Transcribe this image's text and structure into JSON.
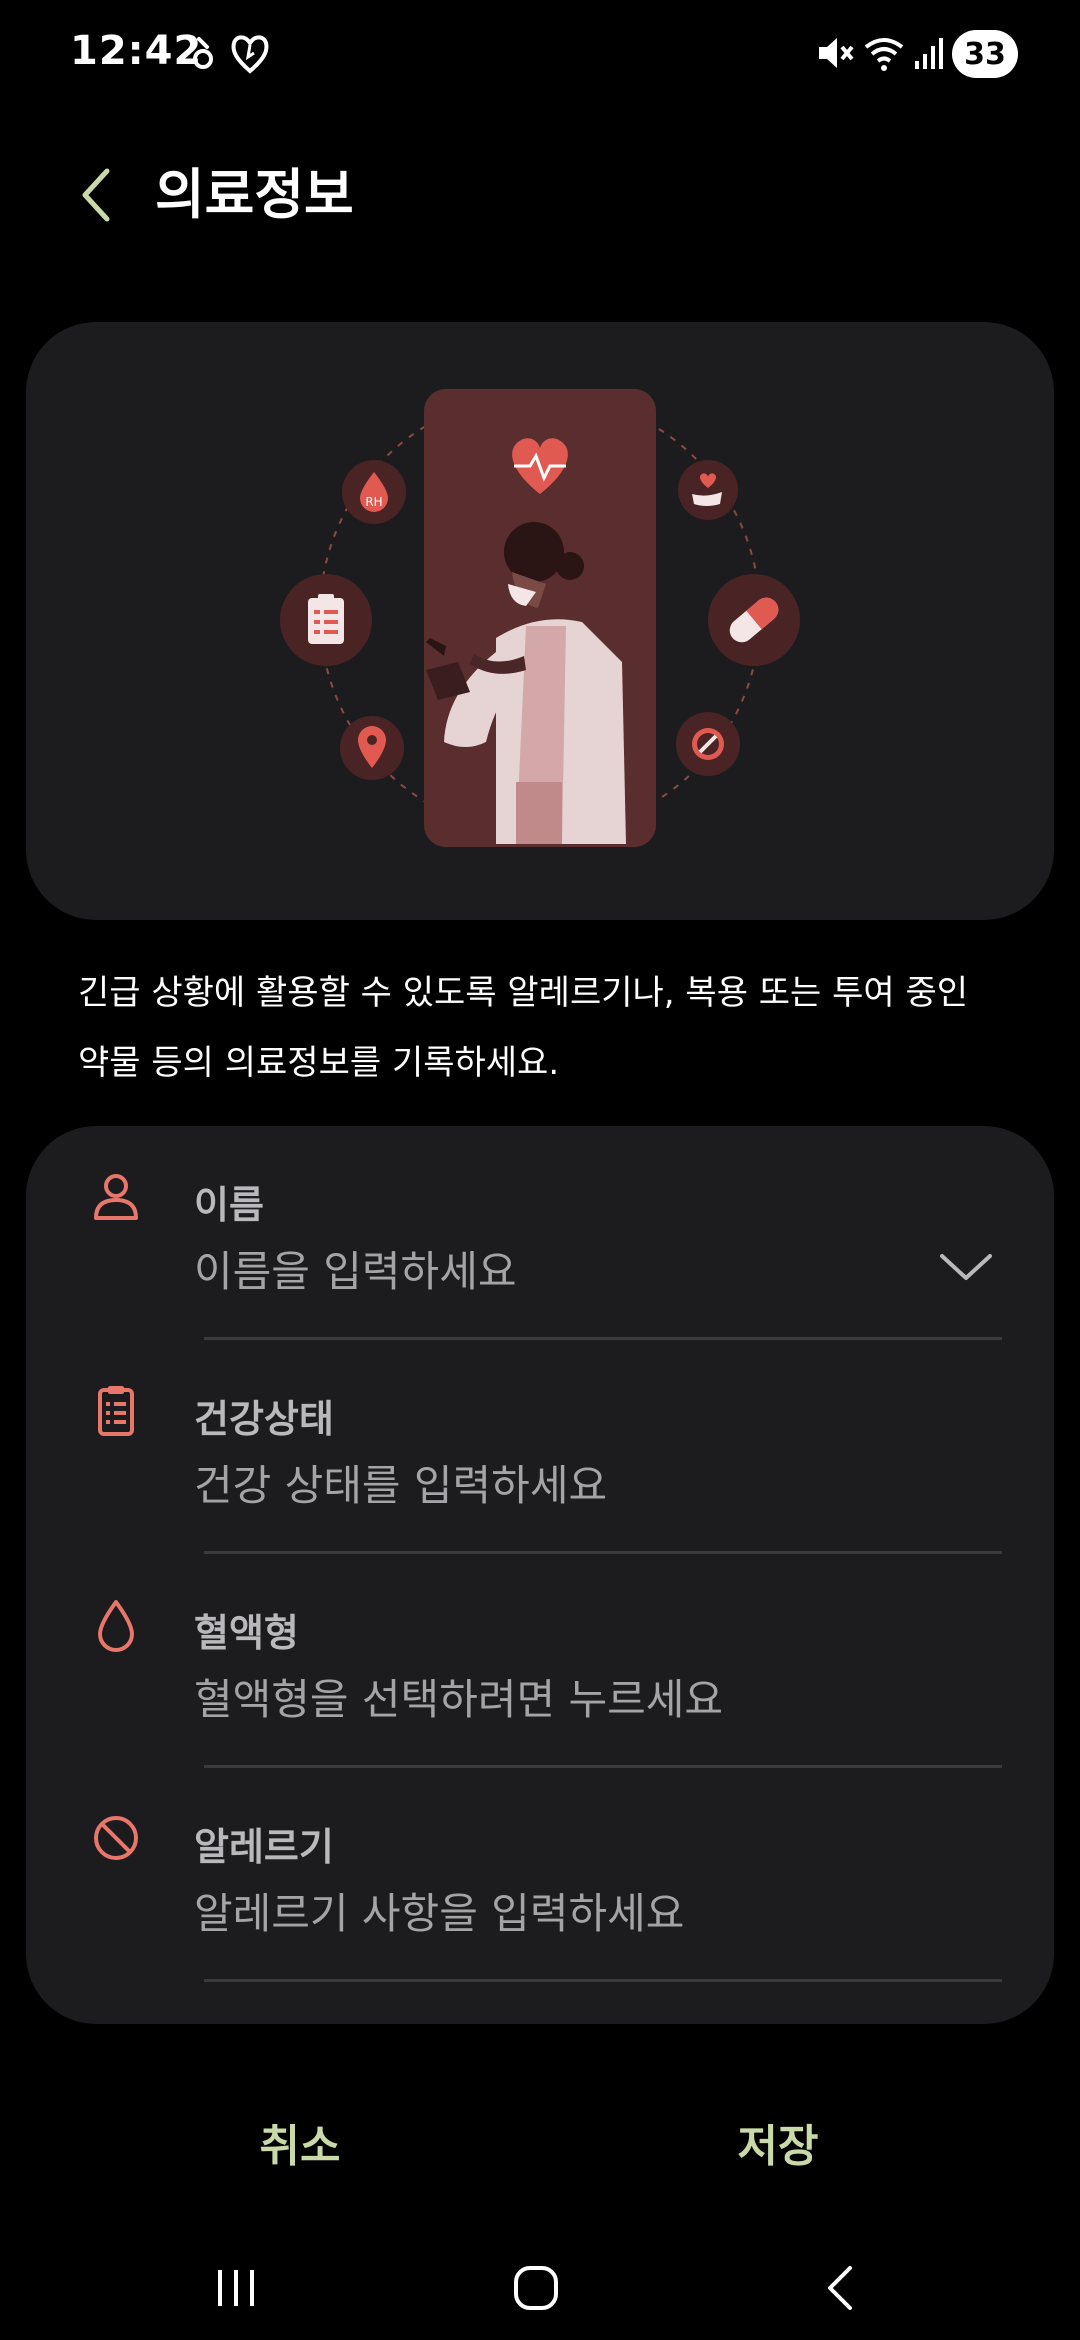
{
  "status_bar": {
    "time": "12:42",
    "battery": "33",
    "icons": [
      "notification-icon",
      "health-icon",
      "mute-icon",
      "wifi-icon",
      "signal-icon",
      "battery-icon"
    ]
  },
  "header": {
    "title": "의료정보",
    "back_icon": "chevron-left-icon"
  },
  "illustration": {
    "icons": [
      "rh-blood-icon",
      "clipboard-icon",
      "location-pin-icon",
      "heart-rate-icon",
      "hand-heart-icon",
      "pill-icon",
      "no-symbol-icon"
    ]
  },
  "description": "긴급 상황에 활용할 수 있도록 알레르기나, 복용 또는 투여 중인 약물 등의 의료정보를 기록하세요.",
  "form": {
    "fields": [
      {
        "label": "이름",
        "placeholder": "이름을 입력하세요",
        "icon": "person-icon",
        "has_dropdown": true
      },
      {
        "label": "건강상태",
        "placeholder": "건강 상태를 입력하세요",
        "icon": "clipboard-icon"
      },
      {
        "label": "혈액형",
        "placeholder": "혈액형을 선택하려면 누르세요",
        "icon": "blood-drop-icon"
      },
      {
        "label": "알레르기",
        "placeholder": "알레르기 사항을 입력하세요",
        "icon": "no-symbol-icon"
      }
    ]
  },
  "actions": {
    "cancel": "취소",
    "save": "저장"
  },
  "navbar": [
    "recent-apps-icon",
    "home-icon",
    "back-icon"
  ],
  "colors": {
    "accent_red": "#e8776b",
    "action_green": "#c9d9a8",
    "card_bg": "#1c1c1e",
    "illus_phone": "#5a2e2e"
  }
}
